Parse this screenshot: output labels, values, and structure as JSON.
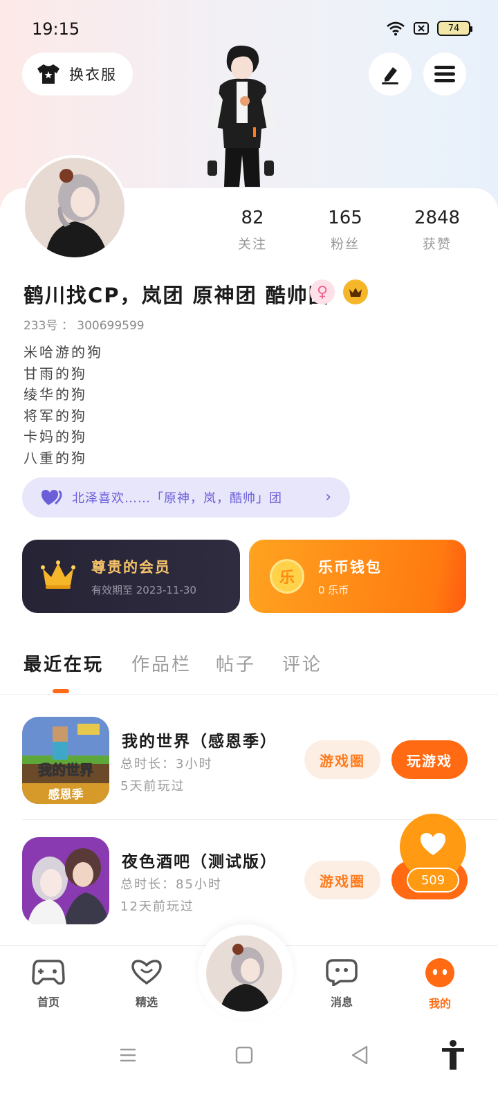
{
  "status_bar": {
    "time": "19:15",
    "battery": "74"
  },
  "header": {
    "outfit_label": "换衣服"
  },
  "stats": [
    {
      "value": "82",
      "label": "关注"
    },
    {
      "value": "165",
      "label": "粉丝"
    },
    {
      "value": "2848",
      "label": "获赞"
    }
  ],
  "profile": {
    "nickname": "鹤川找CP，岚团 原神团 酷帅团",
    "gender_symbol": "♀",
    "uid_label": "233号",
    "uid_value": "300699599",
    "bio": [
      "米哈游的狗",
      "甘雨的狗",
      "绫华的狗",
      "将军的狗",
      "卡妈的狗",
      "八重的狗"
    ]
  },
  "guild": {
    "text": "北泽喜欢……「原神，岚，酷帅」团"
  },
  "vip": {
    "title": "尊贵的会员",
    "subtitle": "有效期至 2023-11-30"
  },
  "wallet": {
    "title": "乐币钱包",
    "subtitle": "0 乐币",
    "coin_char": "乐"
  },
  "tabs": [
    "最近在玩",
    "作品栏",
    "帖子",
    "评论"
  ],
  "games": [
    {
      "name": "我的世界（感恩季）",
      "duration": "总时长：3小时",
      "last_played": "5天前玩过",
      "icon_text_top": "我的世界",
      "icon_text_bottom": "感恩季",
      "circle_label": "游戏圈",
      "play_label": "玩游戏"
    },
    {
      "name": "夜色酒吧（测试版）",
      "duration": "总时长：85小时",
      "last_played": "12天前玩过",
      "circle_label": "游戏圈"
    }
  ],
  "like_fab": {
    "count": "509"
  },
  "bottom_nav": [
    {
      "label": "首页"
    },
    {
      "label": "精选"
    },
    {
      "label": "消息"
    },
    {
      "label": "我的"
    }
  ],
  "colors": {
    "accent": "#ff6a12",
    "guild": "#6b5fd8",
    "vip_bg": "#262335",
    "gold": "#f5b62a"
  }
}
